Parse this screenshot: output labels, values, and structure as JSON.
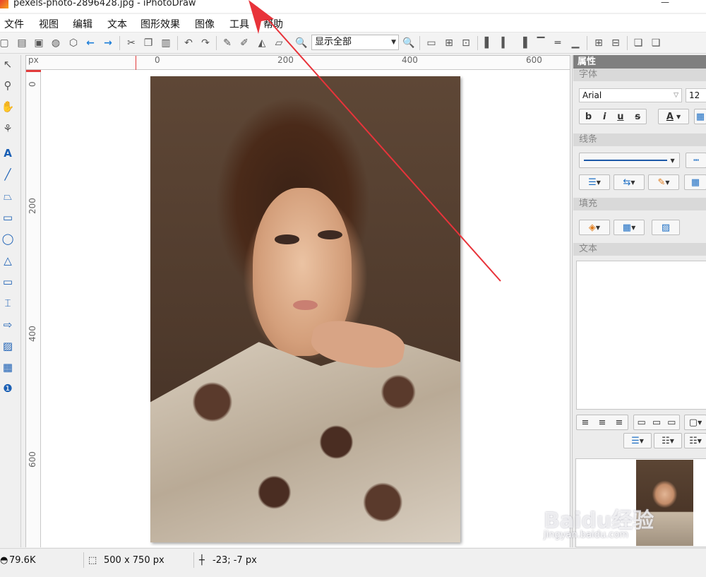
{
  "window": {
    "title": "pexels-photo-2896428.jpg - iPhotoDraw",
    "controls": "—"
  },
  "menu": [
    "文件",
    "视图",
    "编辑",
    "文本",
    "图形效果",
    "图像",
    "工具",
    "帮助"
  ],
  "toolbar": {
    "zoom_value": "显示全部"
  },
  "ruler": {
    "unit": "px",
    "top_ticks": [
      "0",
      "200",
      "400",
      "600"
    ],
    "left_ticks": [
      "0",
      "200",
      "400",
      "600"
    ]
  },
  "properties": {
    "header": "属性",
    "font_section": "字体",
    "font_name": "Arial",
    "font_size": "12",
    "bold": "b",
    "italic": "i",
    "underline": "u",
    "strike": "s",
    "font_color_glyph": "A",
    "line_section": "线条",
    "fill_section": "填充",
    "text_section": "文本"
  },
  "status": {
    "file_size": "79.6K",
    "image_size": "500 x 750 px",
    "cursor_pos": "-23; -7 px"
  },
  "watermark": {
    "text": "Baidu经验",
    "sub": "jingyan.baidu.com"
  },
  "annotation": {
    "arrow_color": "#e8333a"
  }
}
